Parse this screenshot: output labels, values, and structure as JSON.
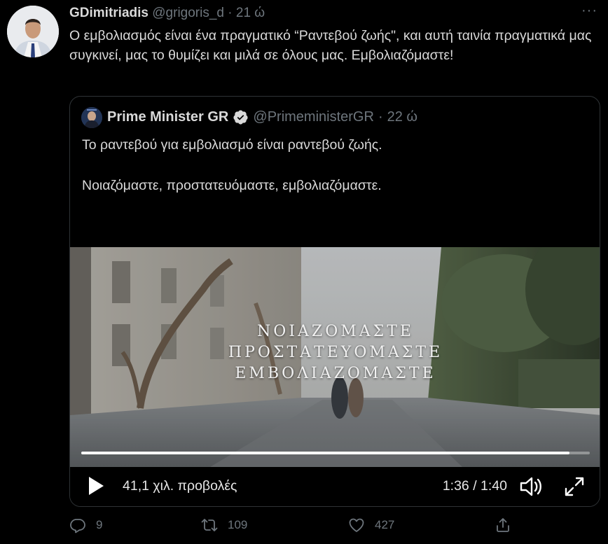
{
  "tweet": {
    "author_name": "GDimitriadis",
    "author_handle": "@grigoris_d",
    "separator": "·",
    "time": "21 ώ",
    "more_label": "···",
    "text": "Ο εμβολιασμός είναι ένα πραγματικό “Ραντεβού ζωής\", και αυτή ταινία πραγματικά μας συγκινεί, μας το θυμίζει και μιλά σε όλους μας. Εμβολιαζόμαστε!"
  },
  "quoted": {
    "author_name": "Prime Minister GR",
    "author_handle": "@PrimeministerGR",
    "separator": "·",
    "time": "22 ώ",
    "line1": "Το ραντεβού για εμβολιασμό είναι ραντεβού ζωής.",
    "line2": "Νοιαζόμαστε, προστατευόμαστε, εμβολιαζόμαστε."
  },
  "video": {
    "overlay_lines": [
      "ΝΟΙΑΖΟΜΑΣΤΕ",
      "ΠΡΟΣΤΑΤΕΥΟΜΑΣΤΕ",
      "ΕΜΒΟΛΙΑΖΟΜΑΣΤΕ"
    ],
    "progress_fraction": 0.96,
    "views": "41,1 χιλ. προβολές",
    "time": "1:36 / 1:40"
  },
  "actions": {
    "replies": "9",
    "retweets": "109",
    "likes": "427"
  },
  "colors": {
    "background": "#000000",
    "text": "#d9d9d9",
    "muted": "#6e767d",
    "verified": "#d9d9d9",
    "border": "#2f3336"
  },
  "icons": [
    "more-icon",
    "verified-icon",
    "play-icon",
    "volume-icon",
    "fullscreen-icon",
    "reply-icon",
    "retweet-icon",
    "like-icon",
    "share-icon"
  ]
}
